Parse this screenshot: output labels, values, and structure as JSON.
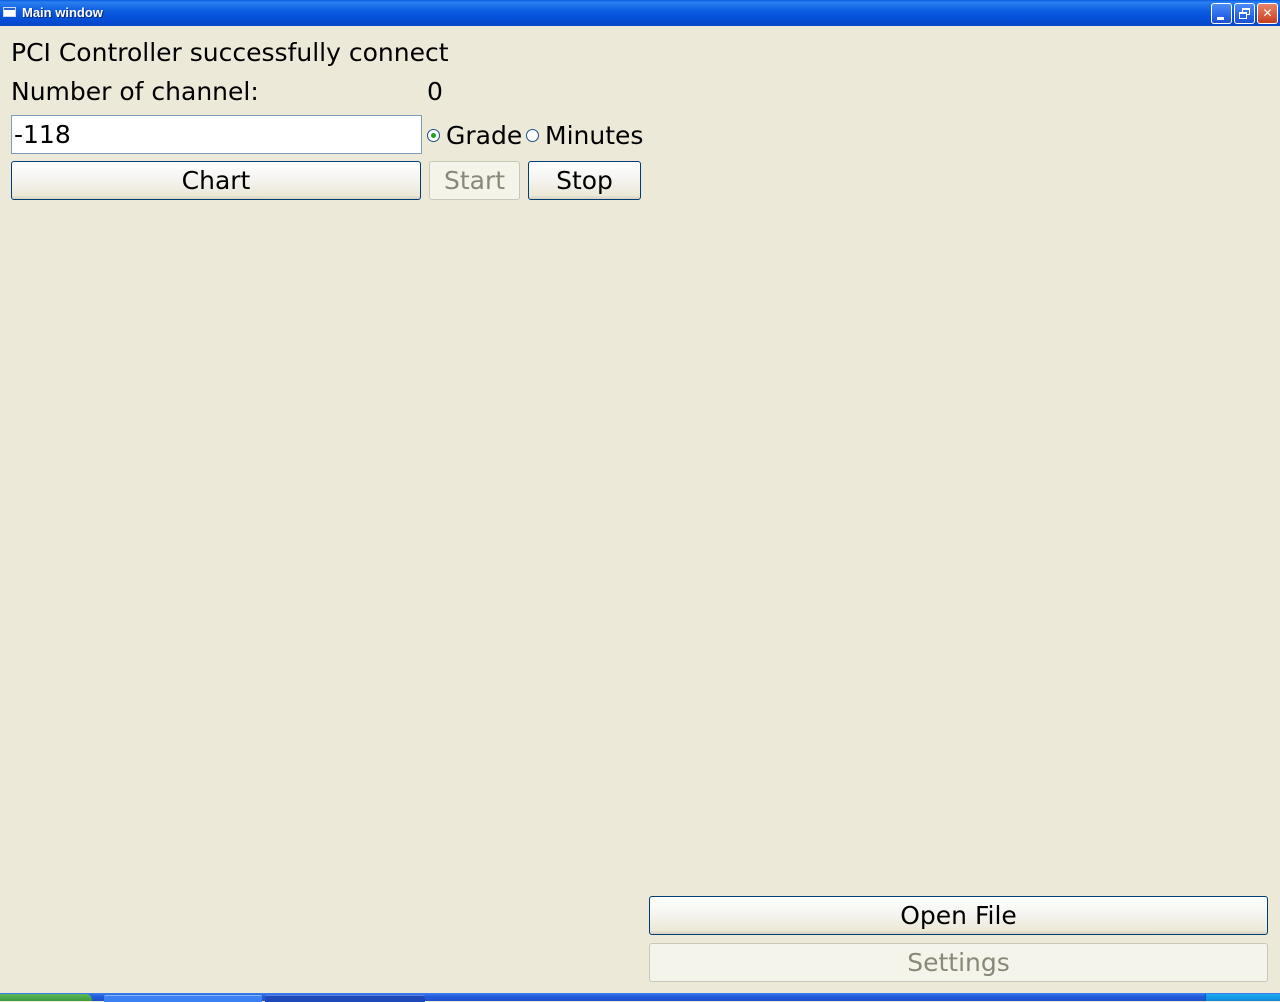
{
  "window": {
    "title": "Main window",
    "icon": "window-app-icon"
  },
  "titlebar_buttons": {
    "minimize_icon": "minimize-icon",
    "restore_icon": "restore-icon",
    "close_icon": "close-icon",
    "close_glyph": "✕"
  },
  "status": {
    "message": "PCI Controller successfully connect"
  },
  "channel": {
    "label": "Number of channel:",
    "value": "0"
  },
  "value_input": {
    "value": "-118"
  },
  "units": {
    "options": [
      "Grade",
      "Minutes"
    ],
    "grade_label": "Grade",
    "minutes_label": "Minutes",
    "selected": "Grade"
  },
  "buttons": {
    "chart": "Chart",
    "start": "Start",
    "stop": "Stop",
    "open_file": "Open File",
    "settings": "Settings"
  },
  "colors": {
    "titlebar": "#0a5ae0",
    "window_bg": "#ece9d8",
    "button_border": "#003c74",
    "disabled_text": "#8a8878",
    "radio_dot": "#21a121"
  }
}
